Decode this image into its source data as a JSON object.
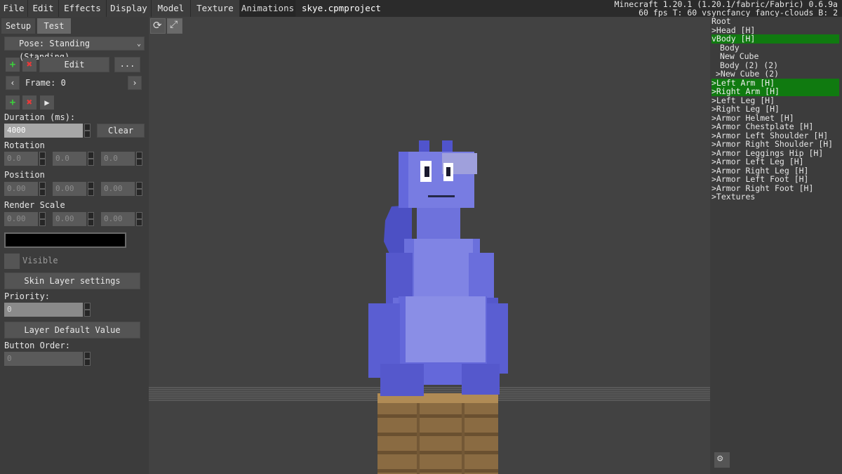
{
  "menu": [
    "File",
    "Edit",
    "Effects",
    "Display",
    "Model",
    "Texture",
    "Animations"
  ],
  "project_title": "skye.cpmproject",
  "mc_info": {
    "line1": "Minecraft 1.20.1 (1.20.1/fabric/Fabric) 0.6.9a",
    "line2": "60 fps T: 60 vsyncfancy fancy-clouds B: 2"
  },
  "left": {
    "tabs": [
      "Setup",
      "Test"
    ],
    "pose_select": "Pose: Standing (Standing)",
    "edit_label": "Edit",
    "more_label": "...",
    "frame_label": "Frame: 0",
    "duration_label": "Duration (ms):",
    "duration_value": "4000",
    "clear_label": "Clear",
    "rotation_label": "Rotation",
    "rotation": [
      "0.0",
      "0.0",
      "0.0"
    ],
    "position_label": "Position",
    "position": [
      "0.00",
      "0.00",
      "0.00"
    ],
    "scale_label": "Render Scale",
    "scale": [
      "0.00",
      "0.00",
      "0.00"
    ],
    "visible_label": "Visible",
    "skin_layer_label": "Skin Layer settings",
    "priority_label": "Priority:",
    "priority_value": "0",
    "layer_default_label": "Layer Default Value",
    "button_order_label": "Button Order:",
    "button_order_value": "0"
  },
  "tree": [
    {
      "text": "Root",
      "selected": false
    },
    {
      "text": ">Head [H]",
      "selected": false
    },
    {
      "text": "vBody [H]",
      "selected": true
    },
    {
      "text": "  Body",
      "selected": false
    },
    {
      "text": "  New Cube",
      "selected": false
    },
    {
      "text": "  Body (2) (2)",
      "selected": false
    },
    {
      "text": " >New Cube (2)",
      "selected": false
    },
    {
      "text": ">Left Arm [H]",
      "selected": true
    },
    {
      "text": ">Right Arm [H]",
      "selected": true
    },
    {
      "text": ">Left Leg [H]",
      "selected": false
    },
    {
      "text": ">Right Leg [H]",
      "selected": false
    },
    {
      "text": ">Armor Helmet [H]",
      "selected": false
    },
    {
      "text": ">Armor Chestplate [H]",
      "selected": false
    },
    {
      "text": ">Armor Left Shoulder [H]",
      "selected": false
    },
    {
      "text": ">Armor Right Shoulder [H]",
      "selected": false
    },
    {
      "text": ">Armor Leggings Hip [H]",
      "selected": false
    },
    {
      "text": ">Armor Left Leg [H]",
      "selected": false
    },
    {
      "text": ">Armor Right Leg [H]",
      "selected": false
    },
    {
      "text": ">Armor Left Foot [H]",
      "selected": false
    },
    {
      "text": ">Armor Right Foot [H]",
      "selected": false
    },
    {
      "text": ">Textures",
      "selected": false
    }
  ],
  "colors": {
    "model_main": "#7d82e0",
    "model_dark": "#5458c8",
    "selected_row": "#107a10",
    "plus": "#3ccf3c",
    "cross": "#e83a3a"
  }
}
